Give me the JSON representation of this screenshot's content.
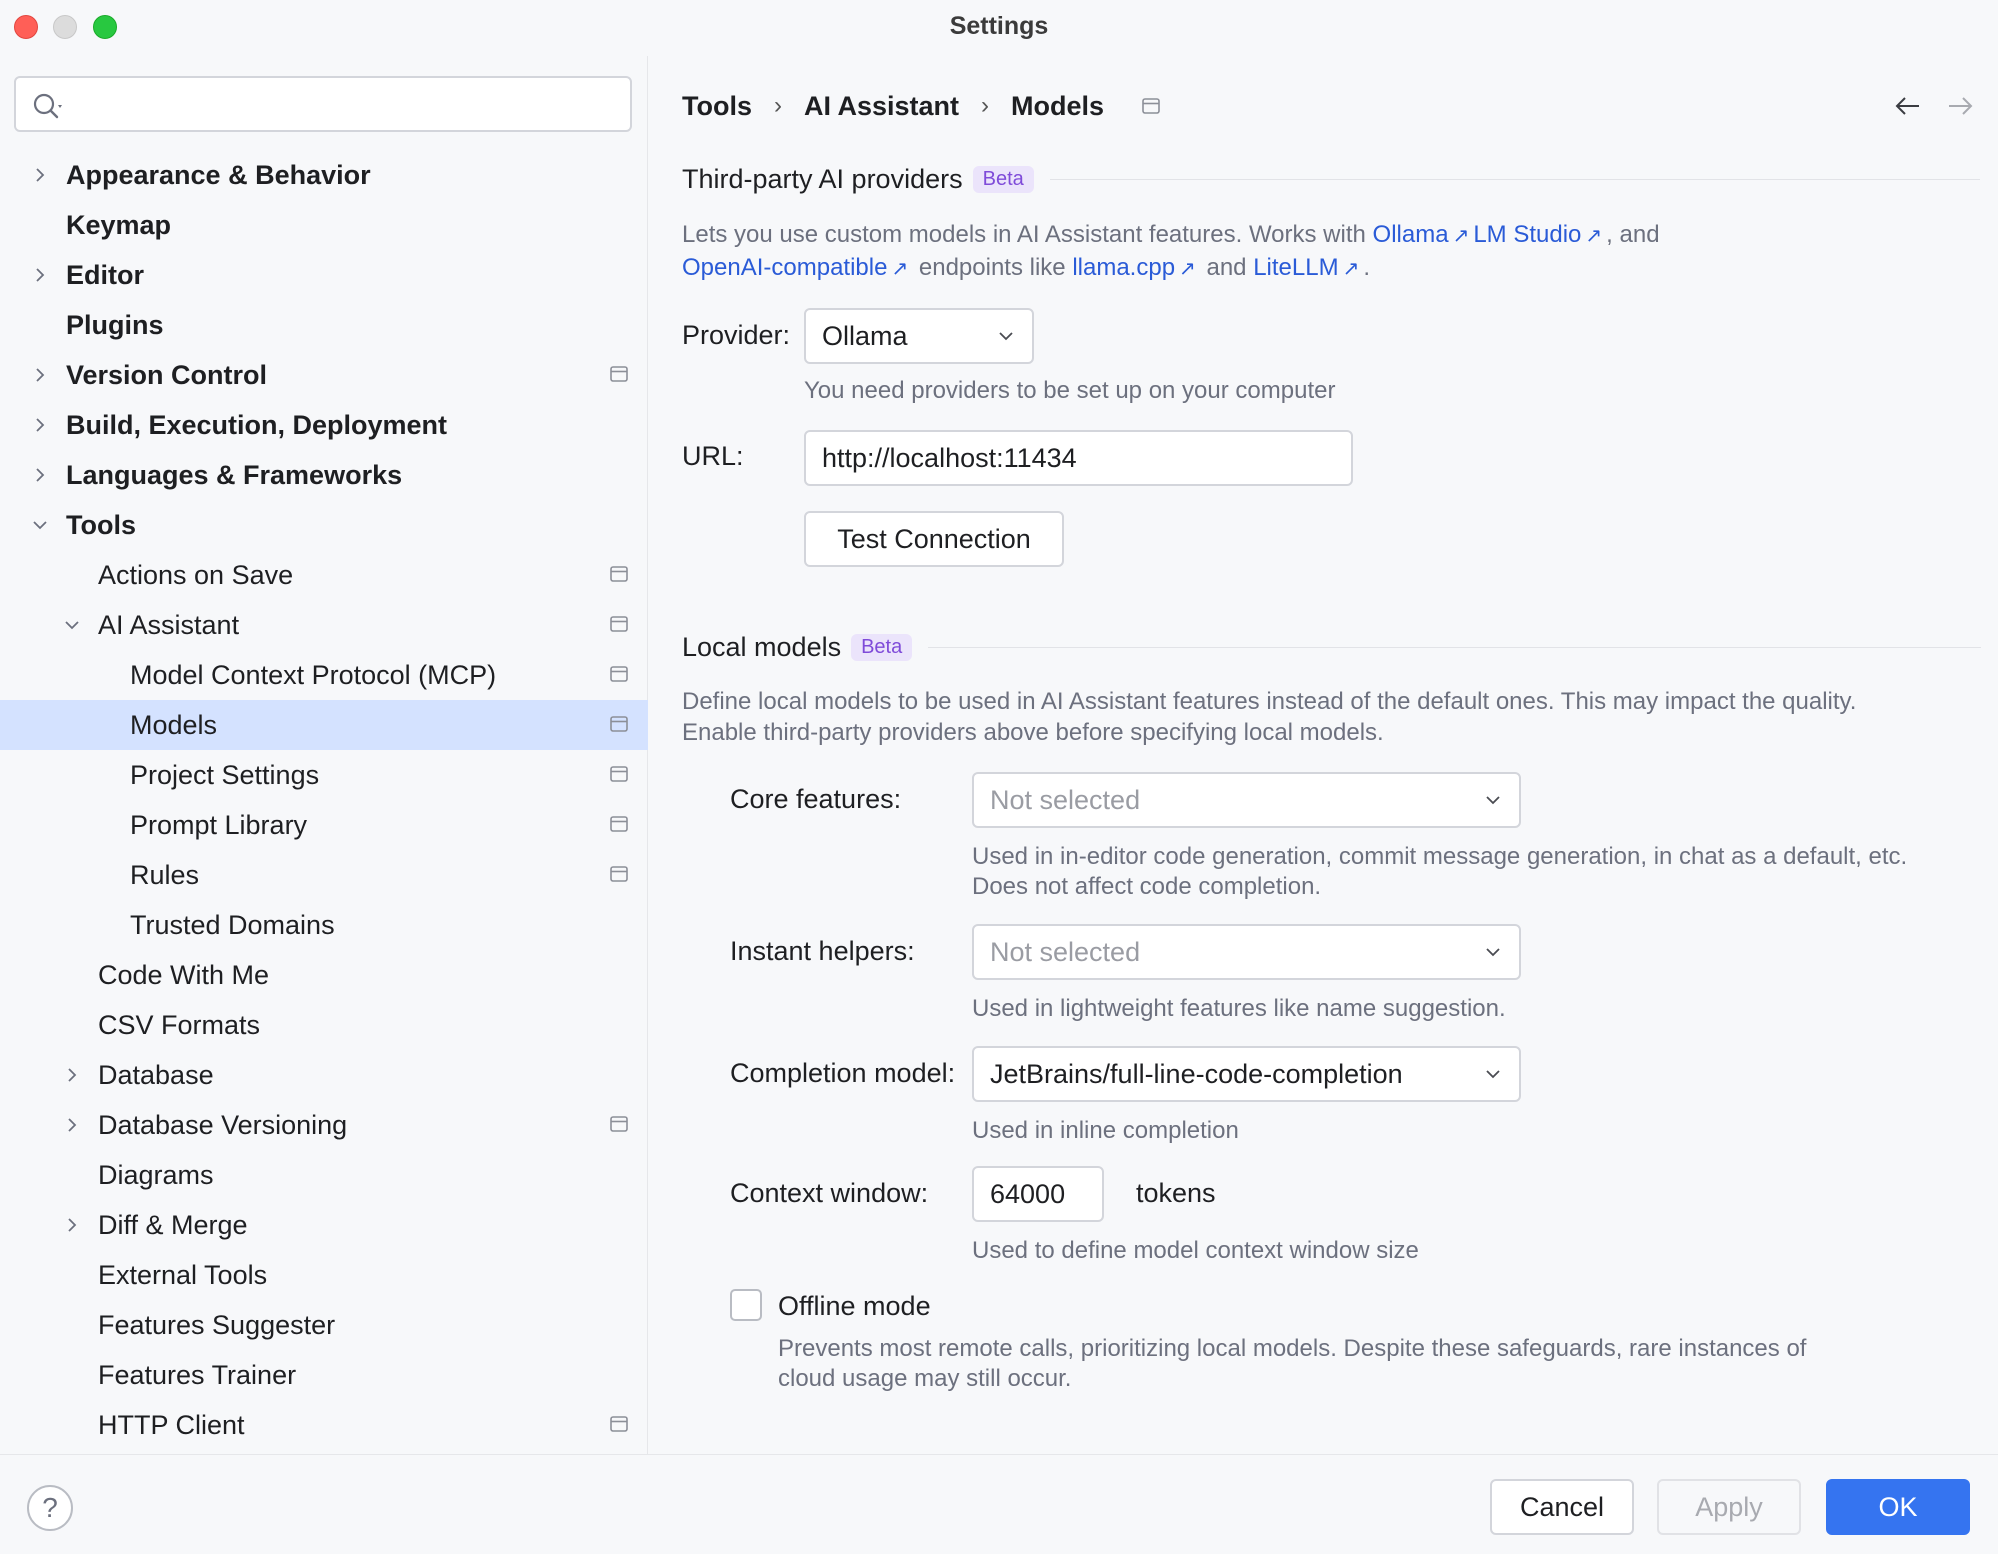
{
  "window": {
    "title": "Settings"
  },
  "sidebar": {
    "search_placeholder": "",
    "items": [
      {
        "label": "Appearance & Behavior",
        "level": 0,
        "bold": true,
        "expandable": true,
        "expanded": false,
        "project": false,
        "selected": false
      },
      {
        "label": "Keymap",
        "level": 0,
        "bold": true,
        "expandable": false,
        "expanded": false,
        "project": false,
        "selected": false
      },
      {
        "label": "Editor",
        "level": 0,
        "bold": true,
        "expandable": true,
        "expanded": false,
        "project": false,
        "selected": false
      },
      {
        "label": "Plugins",
        "level": 0,
        "bold": true,
        "expandable": false,
        "expanded": false,
        "project": false,
        "selected": false
      },
      {
        "label": "Version Control",
        "level": 0,
        "bold": true,
        "expandable": true,
        "expanded": false,
        "project": true,
        "selected": false
      },
      {
        "label": "Build, Execution, Deployment",
        "level": 0,
        "bold": true,
        "expandable": true,
        "expanded": false,
        "project": false,
        "selected": false
      },
      {
        "label": "Languages & Frameworks",
        "level": 0,
        "bold": true,
        "expandable": true,
        "expanded": false,
        "project": false,
        "selected": false
      },
      {
        "label": "Tools",
        "level": 0,
        "bold": true,
        "expandable": true,
        "expanded": true,
        "project": false,
        "selected": false
      },
      {
        "label": "Actions on Save",
        "level": 1,
        "bold": false,
        "expandable": false,
        "expanded": false,
        "project": true,
        "selected": false
      },
      {
        "label": "AI Assistant",
        "level": 1,
        "bold": false,
        "expandable": true,
        "expanded": true,
        "project": true,
        "selected": false
      },
      {
        "label": "Model Context Protocol (MCP)",
        "level": 2,
        "bold": false,
        "expandable": false,
        "expanded": false,
        "project": true,
        "selected": false
      },
      {
        "label": "Models",
        "level": 2,
        "bold": false,
        "expandable": false,
        "expanded": false,
        "project": true,
        "selected": true
      },
      {
        "label": "Project Settings",
        "level": 2,
        "bold": false,
        "expandable": false,
        "expanded": false,
        "project": true,
        "selected": false
      },
      {
        "label": "Prompt Library",
        "level": 2,
        "bold": false,
        "expandable": false,
        "expanded": false,
        "project": true,
        "selected": false
      },
      {
        "label": "Rules",
        "level": 2,
        "bold": false,
        "expandable": false,
        "expanded": false,
        "project": true,
        "selected": false
      },
      {
        "label": "Trusted Domains",
        "level": 2,
        "bold": false,
        "expandable": false,
        "expanded": false,
        "project": false,
        "selected": false
      },
      {
        "label": "Code With Me",
        "level": 1,
        "bold": false,
        "expandable": false,
        "expanded": false,
        "project": false,
        "selected": false
      },
      {
        "label": "CSV Formats",
        "level": 1,
        "bold": false,
        "expandable": false,
        "expanded": false,
        "project": false,
        "selected": false
      },
      {
        "label": "Database",
        "level": 1,
        "bold": false,
        "expandable": true,
        "expanded": false,
        "project": false,
        "selected": false
      },
      {
        "label": "Database Versioning",
        "level": 1,
        "bold": false,
        "expandable": true,
        "expanded": false,
        "project": true,
        "selected": false
      },
      {
        "label": "Diagrams",
        "level": 1,
        "bold": false,
        "expandable": false,
        "expanded": false,
        "project": false,
        "selected": false
      },
      {
        "label": "Diff & Merge",
        "level": 1,
        "bold": false,
        "expandable": true,
        "expanded": false,
        "project": false,
        "selected": false
      },
      {
        "label": "External Tools",
        "level": 1,
        "bold": false,
        "expandable": false,
        "expanded": false,
        "project": false,
        "selected": false
      },
      {
        "label": "Features Suggester",
        "level": 1,
        "bold": false,
        "expandable": false,
        "expanded": false,
        "project": false,
        "selected": false
      },
      {
        "label": "Features Trainer",
        "level": 1,
        "bold": false,
        "expandable": false,
        "expanded": false,
        "project": false,
        "selected": false
      },
      {
        "label": "HTTP Client",
        "level": 1,
        "bold": false,
        "expandable": false,
        "expanded": false,
        "project": true,
        "selected": false
      }
    ]
  },
  "breadcrumb": {
    "items": [
      "Tools",
      "AI Assistant",
      "Models"
    ],
    "separator": "›"
  },
  "third_party": {
    "title": "Third-party AI providers",
    "badge": "Beta",
    "desc_1": "Lets you use custom models in AI Assistant features. Works with",
    "link_ollama": "Ollama",
    "link_lmstudio": "LM Studio",
    "desc_and": ", and",
    "link_openai": "OpenAI-compatible",
    "desc_endpoints": "endpoints like",
    "link_llamacpp": "llama.cpp",
    "desc_and2": "and",
    "link_litellm": "LiteLLM",
    "desc_end": ".",
    "ext_glyph": "↗",
    "provider_label": "Provider:",
    "provider_value": "Ollama",
    "provider_hint": "You need providers to be set up on your computer",
    "url_label": "URL:",
    "url_value": "http://localhost:11434",
    "test_button": "Test Connection"
  },
  "local_models": {
    "title": "Local models",
    "badge": "Beta",
    "desc_line1": "Define local models to be used in AI Assistant features instead of the default ones. This may impact the quality.",
    "desc_line2": "Enable third-party providers above before specifying local models.",
    "core_label": "Core features:",
    "core_value": "Not selected",
    "core_hint_1": "Used in in-editor code generation, commit message generation, in chat as a default, etc.",
    "core_hint_2": "Does not affect code completion.",
    "instant_label": "Instant helpers:",
    "instant_value": "Not selected",
    "instant_hint": "Used in lightweight features like name suggestion.",
    "completion_label": "Completion model:",
    "completion_value": "JetBrains/full-line-code-completion",
    "completion_hint": "Used in inline completion",
    "context_label": "Context window:",
    "context_value": "64000",
    "context_unit": "tokens",
    "context_hint": "Used to define model context window size",
    "offline_label": "Offline mode",
    "offline_checked": false,
    "offline_hint_1": "Prevents most remote calls, prioritizing local models. Despite these safeguards, rare instances of",
    "offline_hint_2": "cloud usage may still occur."
  },
  "footer": {
    "help": "?",
    "cancel": "Cancel",
    "apply": "Apply",
    "ok": "OK"
  },
  "colors": {
    "accent": "#3574f0",
    "selection": "#d4e2ff",
    "link": "#2a5bd7",
    "badge_bg": "#ebe4fb",
    "badge_fg": "#7f4bd9"
  }
}
